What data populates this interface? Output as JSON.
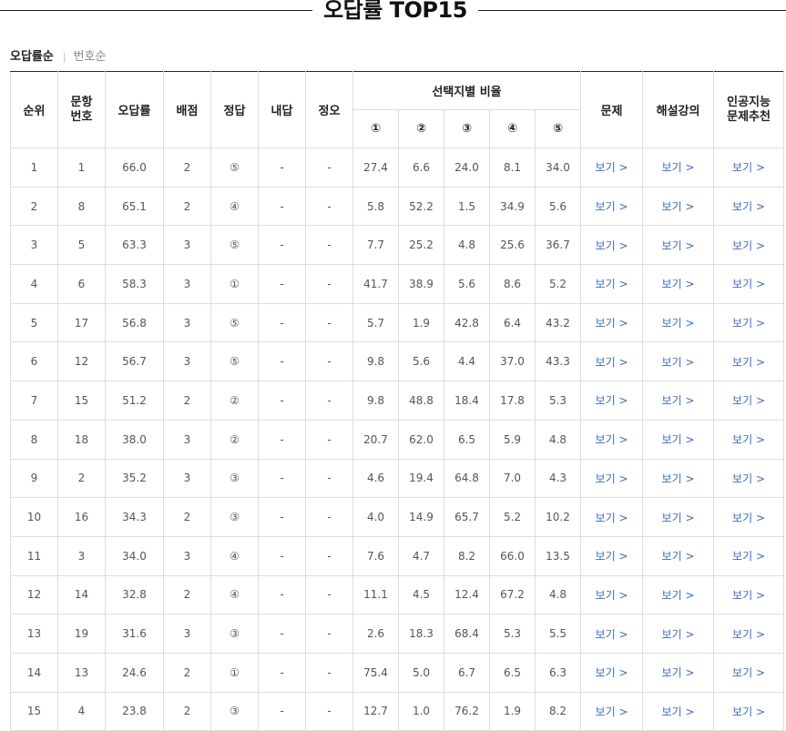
{
  "title": "오답률 TOP15",
  "sort": {
    "active": "오답률순",
    "separator": "|",
    "other": "번호순"
  },
  "headers": {
    "rank": "순위",
    "question_no": [
      "문항",
      "번호"
    ],
    "wrong_rate": "오답률",
    "points": "배점",
    "answer": "정답",
    "my_answer": "내답",
    "correct": "정오",
    "choice_ratio": "선택지별 비율",
    "choices": [
      "①",
      "②",
      "③",
      "④",
      "⑤"
    ],
    "problem": "문제",
    "lecture": "해설강의",
    "ai": [
      "인공지능",
      "문제추천"
    ]
  },
  "view_label": "보기 >",
  "rows": [
    {
      "rank": "1",
      "no": "1",
      "rate": "66.0",
      "pts": "2",
      "ans": "⑤",
      "mine": "-",
      "ox": "-",
      "c": [
        "27.4",
        "6.6",
        "24.0",
        "8.1",
        "34.0"
      ]
    },
    {
      "rank": "2",
      "no": "8",
      "rate": "65.1",
      "pts": "2",
      "ans": "④",
      "mine": "-",
      "ox": "-",
      "c": [
        "5.8",
        "52.2",
        "1.5",
        "34.9",
        "5.6"
      ]
    },
    {
      "rank": "3",
      "no": "5",
      "rate": "63.3",
      "pts": "3",
      "ans": "⑤",
      "mine": "-",
      "ox": "-",
      "c": [
        "7.7",
        "25.2",
        "4.8",
        "25.6",
        "36.7"
      ]
    },
    {
      "rank": "4",
      "no": "6",
      "rate": "58.3",
      "pts": "3",
      "ans": "①",
      "mine": "-",
      "ox": "-",
      "c": [
        "41.7",
        "38.9",
        "5.6",
        "8.6",
        "5.2"
      ]
    },
    {
      "rank": "5",
      "no": "17",
      "rate": "56.8",
      "pts": "3",
      "ans": "⑤",
      "mine": "-",
      "ox": "-",
      "c": [
        "5.7",
        "1.9",
        "42.8",
        "6.4",
        "43.2"
      ]
    },
    {
      "rank": "6",
      "no": "12",
      "rate": "56.7",
      "pts": "3",
      "ans": "⑤",
      "mine": "-",
      "ox": "-",
      "c": [
        "9.8",
        "5.6",
        "4.4",
        "37.0",
        "43.3"
      ]
    },
    {
      "rank": "7",
      "no": "15",
      "rate": "51.2",
      "pts": "2",
      "ans": "②",
      "mine": "-",
      "ox": "-",
      "c": [
        "9.8",
        "48.8",
        "18.4",
        "17.8",
        "5.3"
      ]
    },
    {
      "rank": "8",
      "no": "18",
      "rate": "38.0",
      "pts": "3",
      "ans": "②",
      "mine": "-",
      "ox": "-",
      "c": [
        "20.7",
        "62.0",
        "6.5",
        "5.9",
        "4.8"
      ]
    },
    {
      "rank": "9",
      "no": "2",
      "rate": "35.2",
      "pts": "3",
      "ans": "③",
      "mine": "-",
      "ox": "-",
      "c": [
        "4.6",
        "19.4",
        "64.8",
        "7.0",
        "4.3"
      ]
    },
    {
      "rank": "10",
      "no": "16",
      "rate": "34.3",
      "pts": "2",
      "ans": "③",
      "mine": "-",
      "ox": "-",
      "c": [
        "4.0",
        "14.9",
        "65.7",
        "5.2",
        "10.2"
      ]
    },
    {
      "rank": "11",
      "no": "3",
      "rate": "34.0",
      "pts": "3",
      "ans": "④",
      "mine": "-",
      "ox": "-",
      "c": [
        "7.6",
        "4.7",
        "8.2",
        "66.0",
        "13.5"
      ]
    },
    {
      "rank": "12",
      "no": "14",
      "rate": "32.8",
      "pts": "2",
      "ans": "④",
      "mine": "-",
      "ox": "-",
      "c": [
        "11.1",
        "4.5",
        "12.4",
        "67.2",
        "4.8"
      ]
    },
    {
      "rank": "13",
      "no": "19",
      "rate": "31.6",
      "pts": "3",
      "ans": "③",
      "mine": "-",
      "ox": "-",
      "c": [
        "2.6",
        "18.3",
        "68.4",
        "5.3",
        "5.5"
      ]
    },
    {
      "rank": "14",
      "no": "13",
      "rate": "24.6",
      "pts": "2",
      "ans": "①",
      "mine": "-",
      "ox": "-",
      "c": [
        "75.4",
        "5.0",
        "6.7",
        "6.5",
        "6.3"
      ]
    },
    {
      "rank": "15",
      "no": "4",
      "rate": "23.8",
      "pts": "2",
      "ans": "③",
      "mine": "-",
      "ox": "-",
      "c": [
        "12.7",
        "1.0",
        "76.2",
        "1.9",
        "8.2"
      ]
    }
  ]
}
